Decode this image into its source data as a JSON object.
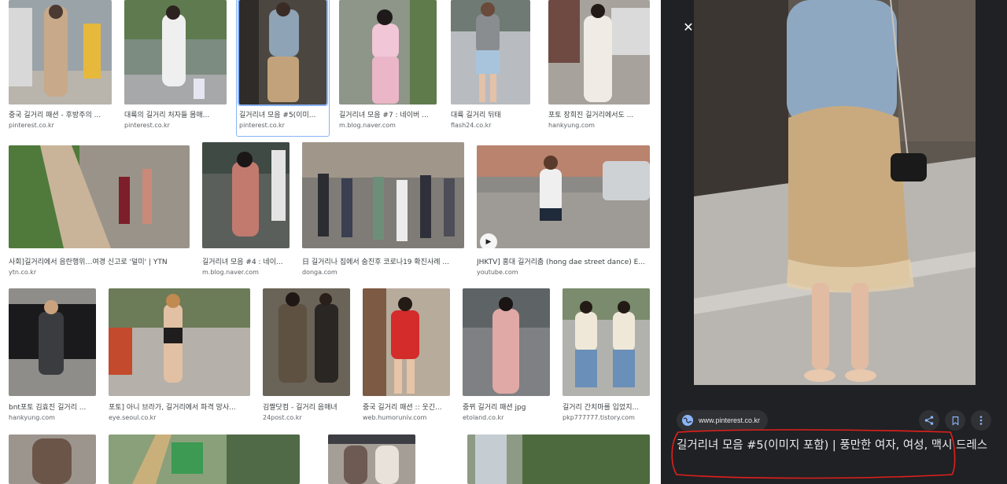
{
  "results": [
    {
      "title": "중국 길거리 패션 - 후방주의 ...",
      "source": "pinterest.co.kr"
    },
    {
      "title": "대륙의 길거리 처자들 몸매...",
      "source": "pinterest.co.kr"
    },
    {
      "title": "길거리녀 모음 #5(이미...",
      "source": "pinterest.co.kr"
    },
    {
      "title": "길거리녀 모음 #7 : 네이버 ...",
      "source": "m.blog.naver.com"
    },
    {
      "title": "대륙 길거리 뒤태",
      "source": "flash24.co.kr"
    },
    {
      "title": "포토 장희진 길거리에서도 ...",
      "source": "hankyung.com"
    },
    {
      "title": "사회]길거리에서 음란행위…여경 신고로 '덜미' | YTN",
      "source": "ytn.co.kr"
    },
    {
      "title": "길거리녀 모음 #4 : 네이...",
      "source": "m.blog.naver.com"
    },
    {
      "title": "日 길거리나 집에서 숨진후 코로나19 확진사례 ...",
      "source": "donga.com"
    },
    {
      "title": "JHKTV] 홍대 길거리춤 (hong dae street dance) E...",
      "source": "youtube.com"
    },
    {
      "title": "bnt포토 김효진 길거리 ...",
      "source": "hankyung.com"
    },
    {
      "title": "포토] 아니 브라가, 길거리에서 파격 망사...",
      "source": "eye.seoul.co.kr"
    },
    {
      "title": "김짤닷컴 - 길거리 음매녀",
      "source": "24post.co.kr"
    },
    {
      "title": "중국 길거리 패션 :: 웃긴...",
      "source": "web.humoruniv.com"
    },
    {
      "title": "중뀌 길거리 패션 jpg",
      "source": "etoland.co.kr"
    },
    {
      "title": "길거리 간치마를 입었지...",
      "source": "pkp777777.tistory.com"
    }
  ],
  "panel": {
    "close_icon": "✕",
    "source_domain": "www.pinterest.co.kr",
    "title": "길거리녀 모음 #5(이미지 포함) | 풍만한 여자, 여성, 맥시 드레스",
    "actions": [
      "share-icon",
      "bookmark-icon",
      "more-vert-icon"
    ]
  },
  "colors": {
    "panel_bg": "#202124",
    "chip_bg": "#303134",
    "accent": "#8ab4f8",
    "annotation": "#e0201c"
  }
}
